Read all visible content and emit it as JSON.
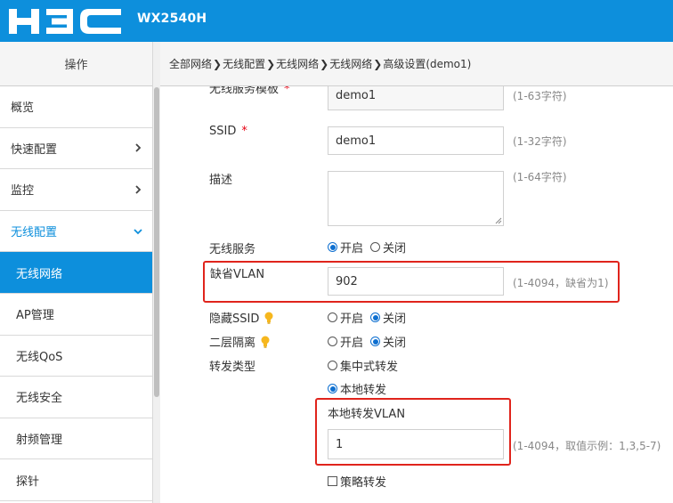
{
  "header": {
    "brand": "H3C",
    "model": "WX2540H"
  },
  "sidebar": {
    "title": "操作",
    "items": [
      {
        "label": "概览"
      },
      {
        "label": "快速配置"
      },
      {
        "label": "监控"
      },
      {
        "label": "无线配置"
      },
      {
        "label": "无线网络"
      },
      {
        "label": "AP管理"
      },
      {
        "label": "无线QoS"
      },
      {
        "label": "无线安全"
      },
      {
        "label": "射频管理"
      },
      {
        "label": "探针"
      }
    ]
  },
  "breadcrumb": [
    "全部网络",
    "无线配置",
    "无线网络",
    "无线网络",
    "高级设置(demo1)"
  ],
  "form": {
    "service_template": {
      "label": "无线服务模板",
      "value": "demo1",
      "hint": "(1-63字符)"
    },
    "ssid": {
      "label": "SSID",
      "value": "demo1",
      "hint": "(1-32字符)"
    },
    "desc": {
      "label": "描述",
      "value": "",
      "hint": "(1-64字符)"
    },
    "wireless_service": {
      "label": "无线服务",
      "opt_on": "开启",
      "opt_off": "关闭",
      "selected": "开启"
    },
    "default_vlan": {
      "label": "缺省VLAN",
      "value": "902",
      "hint": "(1-4094，缺省为1)"
    },
    "hide_ssid": {
      "label": "隐藏SSID",
      "opt_on": "开启",
      "opt_off": "关闭",
      "selected": "关闭"
    },
    "l2_isolation": {
      "label": "二层隔离",
      "opt_on": "开启",
      "opt_off": "关闭",
      "selected": "关闭"
    },
    "forward_type": {
      "label": "转发类型",
      "opt_central": "集中式转发",
      "opt_local": "本地转发",
      "selected": "本地转发"
    },
    "local_vlan": {
      "label": "本地转发VLAN",
      "value": "1",
      "hint": "(1-4094，取值示例：1,3,5-7)"
    },
    "policy_forward": {
      "label": "策略转发",
      "checked": false
    }
  },
  "colors": {
    "brand_blue": "#0d8fdc",
    "highlight_red": "#e0241c",
    "required_red": "#e60012"
  }
}
